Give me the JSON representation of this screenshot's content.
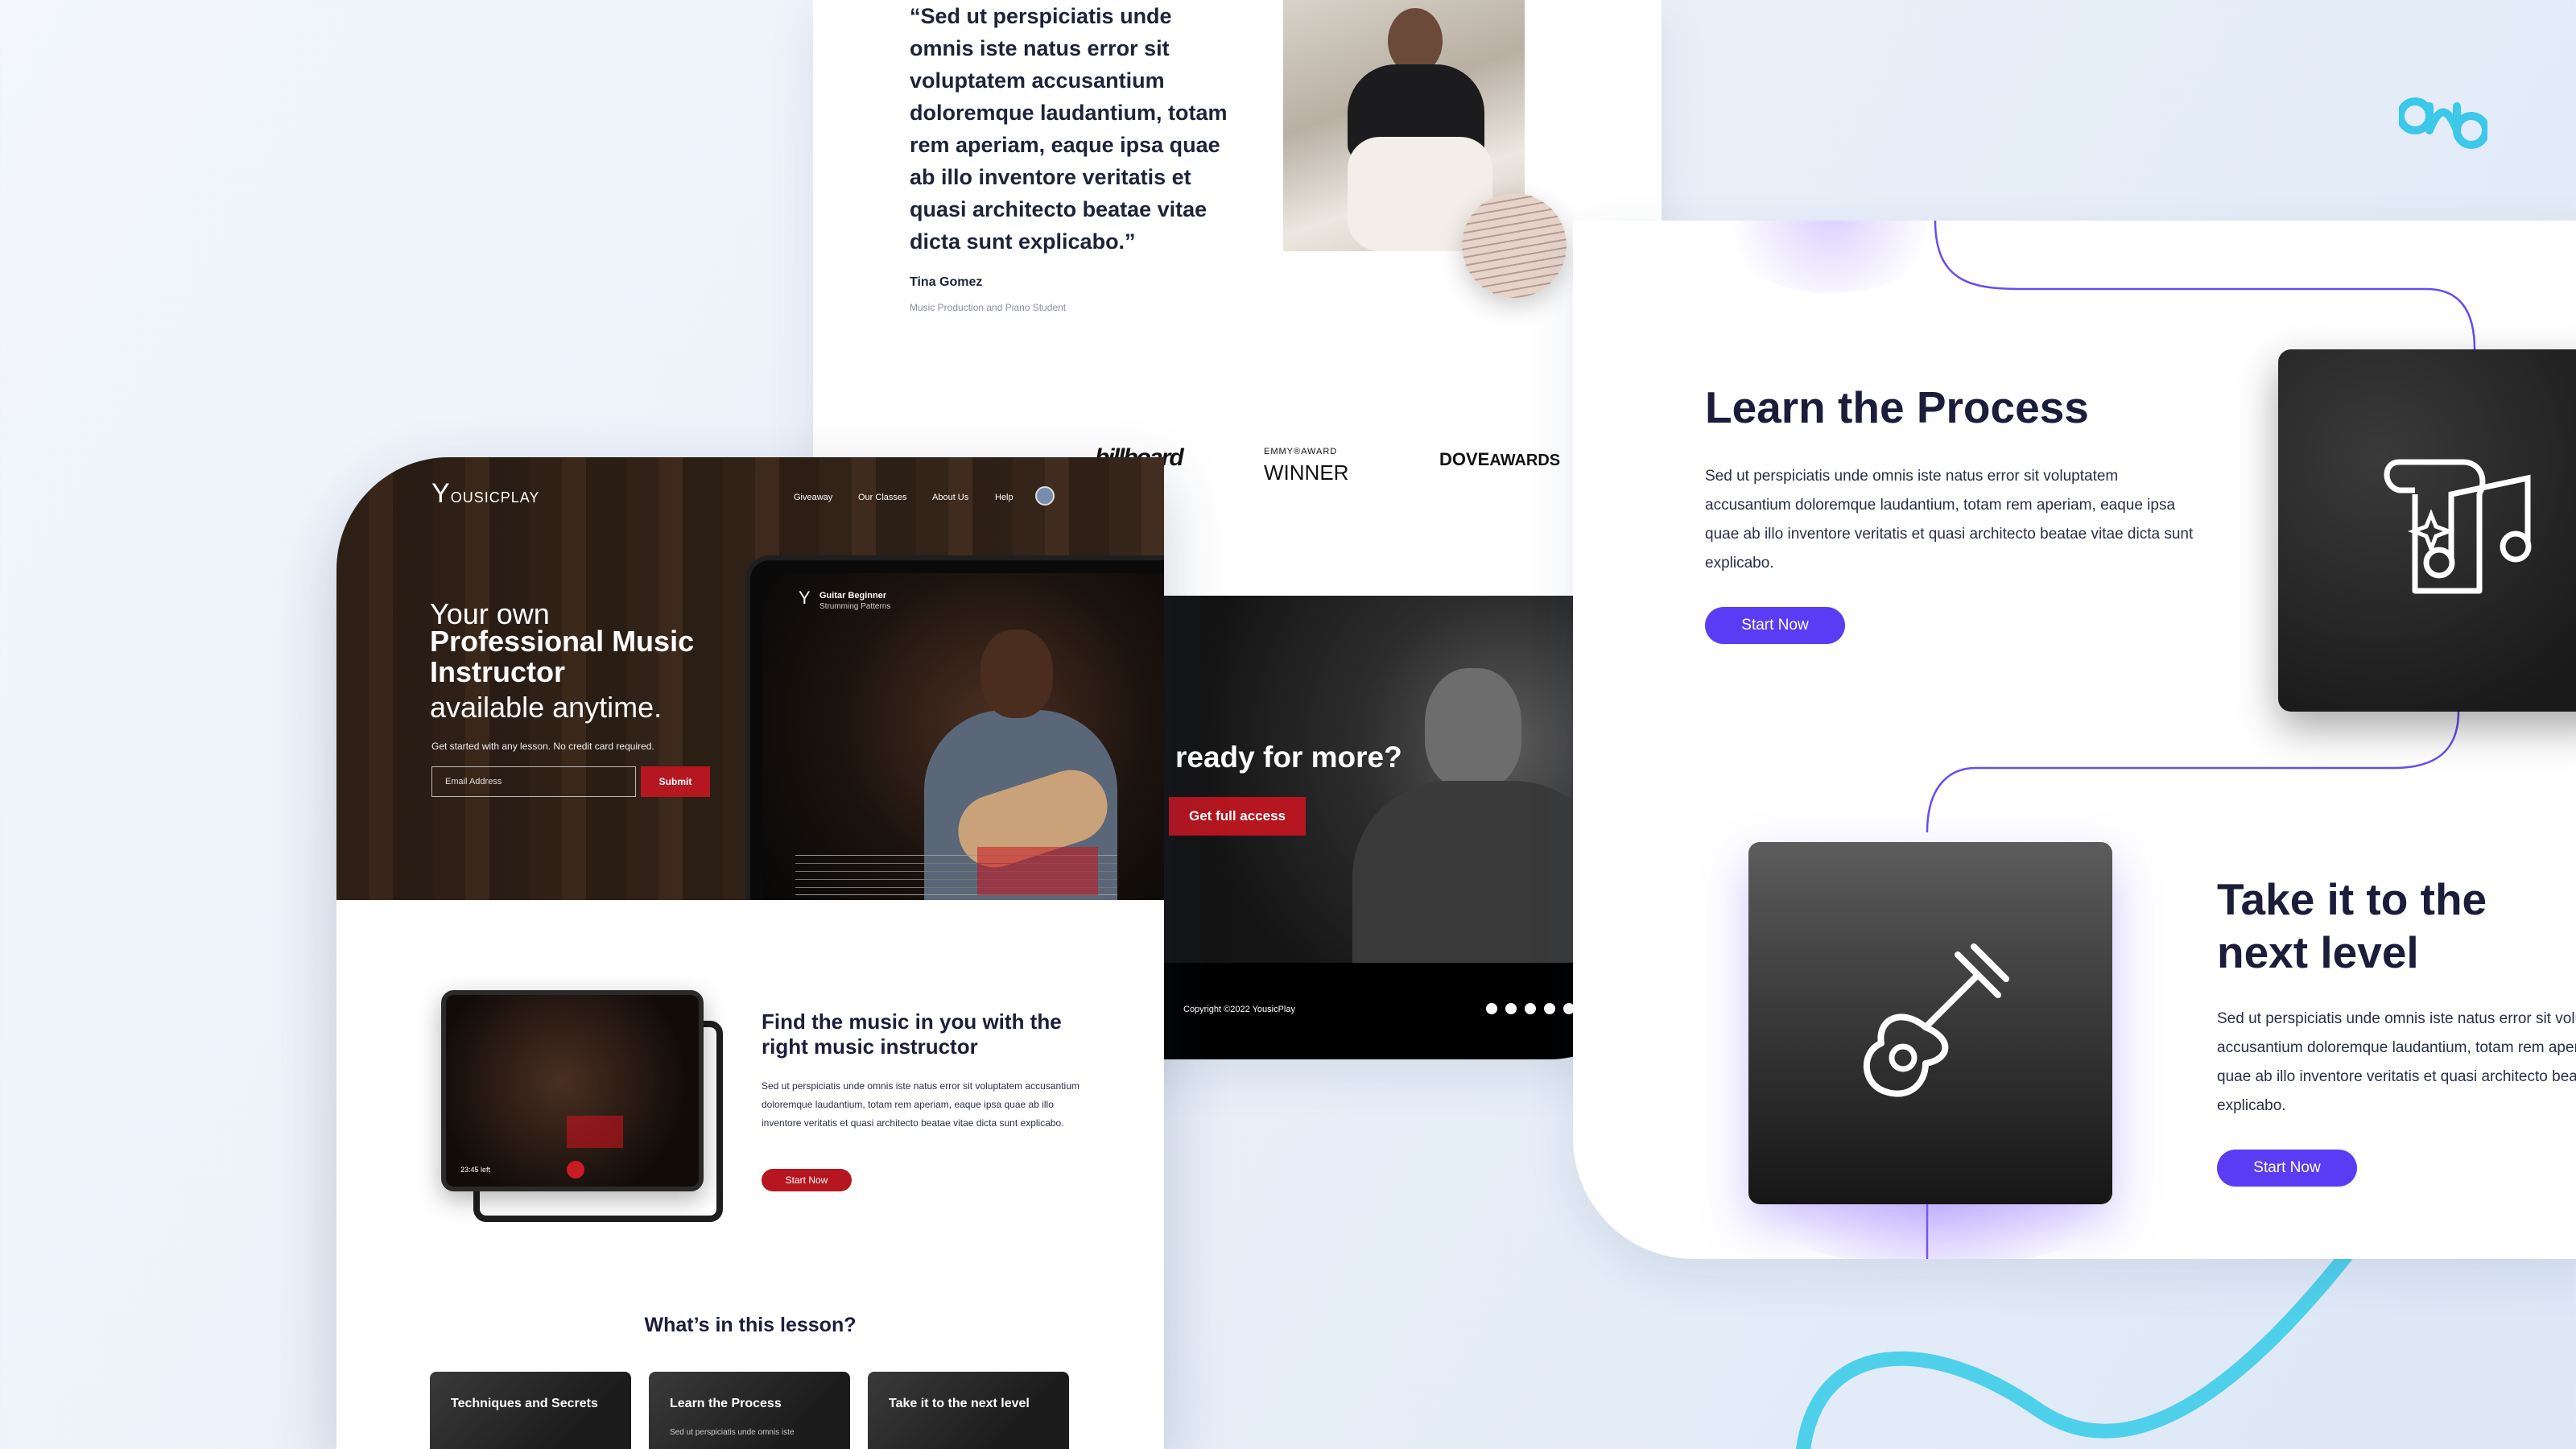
{
  "testimonial": {
    "quote": "“Sed ut perspiciatis unde omnis iste natus error sit voluptatem accusantium doloremque laudantium, totam rem aperiam, eaque ipsa quae ab illo inventore veritatis et quasi architecto beatae vitae dicta sunt explicabo.”",
    "author": "Tina Gomez",
    "role": "Music Production and Piano Student"
  },
  "logos": {
    "billboard": "billboard",
    "emmy_top": "EMMY®AWARD",
    "emmy_main": "WINNER",
    "dove_prefix": "DOVE",
    "dove_suffix": "AWARDS"
  },
  "cta_section": {
    "title": "ready for more?",
    "button": "Get full access"
  },
  "footer": {
    "copyright": "Copyright ©2022 YousicPlay",
    "social_icons": [
      "facebook-icon",
      "instagram-icon",
      "youtube-icon",
      "twitter-icon",
      "linkedin-icon"
    ]
  },
  "right_panel": {
    "learn_title": "Learn the Process",
    "learn_text": "Sed ut perspiciatis unde omnis iste natus error sit voluptatem accusantium doloremque laudantium, totam rem aperiam, eaque ipsa quae ab illo inventore veritatis et quasi architecto beatae vitae dicta sunt explicabo.",
    "learn_button": "Start Now",
    "next_title": "Take it to the next level",
    "next_text": "Sed ut perspiciatis unde omnis iste natus error sit voluptatem accusantium doloremque laudantium, totam rem aperiam, eaque ipsa quae ab illo inventore veritatis et quasi architecto beatae vitae dicta sunt explicabo.",
    "next_button": "Start Now"
  },
  "site": {
    "brand_letter": "Y",
    "brand_name": "OUSICPLAY",
    "nav": [
      "Giveaway",
      "Our Classes",
      "About Us",
      "Help"
    ],
    "hero": {
      "line1": "Your own",
      "line2": "Professional Music Instructor",
      "line3": "available anytime.",
      "subtitle": "Get started with any lesson. No credit card required.",
      "email_placeholder": "Email Address",
      "submit": "Submit"
    },
    "tablet": {
      "lesson_title": "Guitar Beginner",
      "lesson_sub": "Strumming Patterns"
    },
    "mini_tablet": {
      "time": "23:45 left"
    },
    "find": {
      "title": "Find the music in you with the right music instructor",
      "text": "Sed ut perspiciatis unde omnis iste natus error sit voluptatem accusantium doloremque laudantium, totam rem aperiam, eaque ipsa quae ab illo inventore veritatis et quasi architecto beatae vitae dicta sunt explicabo.",
      "button": "Start Now"
    },
    "lesson_heading": "What’s in this lesson?",
    "cards": [
      {
        "title": "Techniques and Secrets",
        "text": ""
      },
      {
        "title": "Learn the Process",
        "text": "Sed ut perspiciatis unde omnis iste"
      },
      {
        "title": "Take it to the next level",
        "text": ""
      }
    ]
  },
  "colors": {
    "accent_purple": "#5b3cf5",
    "accent_red": "#b5161f",
    "brand_cyan": "#3cc8e8",
    "heading_navy": "#1b1d3a"
  }
}
